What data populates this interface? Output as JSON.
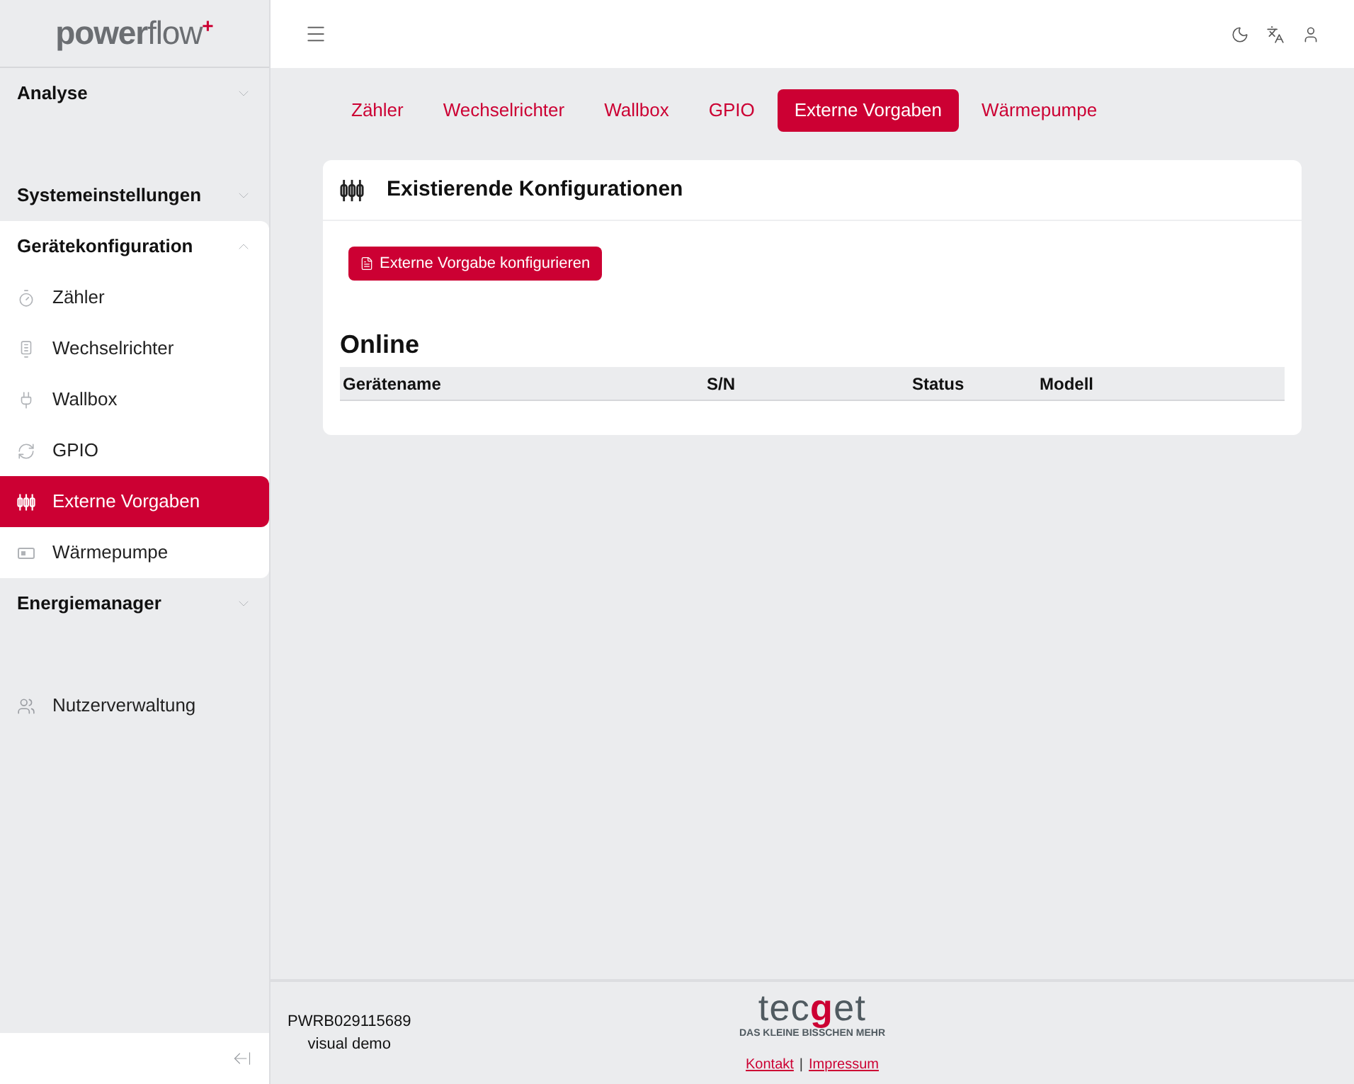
{
  "brand": {
    "bold": "power",
    "light": "flow",
    "mark": "+"
  },
  "sidebar": {
    "items": [
      {
        "kind": "section",
        "label": "Analyse",
        "expanded": false
      },
      {
        "kind": "section",
        "label": "Systemeinstellungen",
        "expanded": false
      },
      {
        "kind": "section",
        "label": "Gerätekonfiguration",
        "expanded": true,
        "children": [
          {
            "label": "Zähler",
            "selected": false
          },
          {
            "label": "Wechselrichter",
            "selected": false
          },
          {
            "label": "Wallbox",
            "selected": false
          },
          {
            "label": "GPIO",
            "selected": false
          },
          {
            "label": "Externe Vorgaben",
            "selected": true
          },
          {
            "label": "Wärmepumpe",
            "selected": false
          }
        ]
      },
      {
        "kind": "section",
        "label": "Energiemanager",
        "expanded": false
      },
      {
        "kind": "link",
        "label": "Nutzerverwaltung"
      }
    ]
  },
  "tabs": [
    {
      "label": "Zähler",
      "selected": false
    },
    {
      "label": "Wechselrichter",
      "selected": false
    },
    {
      "label": "Wallbox",
      "selected": false
    },
    {
      "label": "GPIO",
      "selected": false
    },
    {
      "label": "Externe Vorgaben",
      "selected": true
    },
    {
      "label": "Wärmepumpe",
      "selected": false
    }
  ],
  "card": {
    "title": "Existierende Konfigurationen",
    "button": "Externe Vorgabe konfigurieren",
    "section_title": "Online",
    "table": {
      "columns": [
        "Gerätename",
        "S/N",
        "Status",
        "Modell"
      ]
    }
  },
  "footer": {
    "serial": "PWRB029115689",
    "device": "visual demo",
    "logo": [
      {
        "text": "tec",
        "accent": false
      },
      {
        "text": "g",
        "accent": true
      },
      {
        "text": "et",
        "accent": false
      }
    ],
    "tagline": "DAS KLEINE BISSCHEN MEHR",
    "links": [
      "Kontakt",
      "Impressum"
    ],
    "separator": "|"
  }
}
